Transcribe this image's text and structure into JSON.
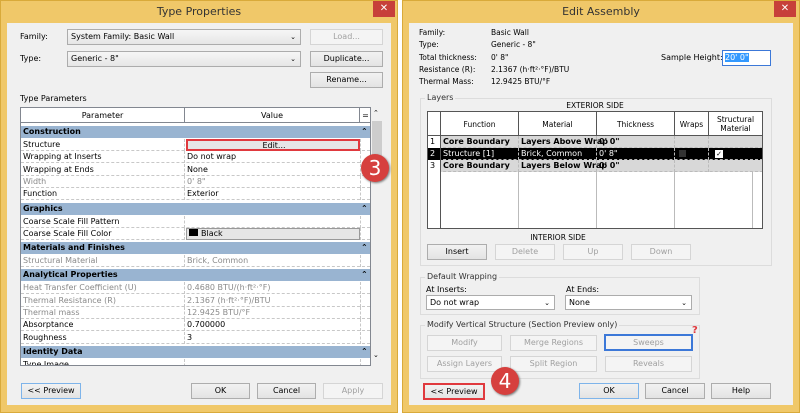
{
  "type_properties": {
    "title": "Type Properties",
    "family_label": "Family:",
    "family_value": "System Family: Basic Wall",
    "type_label": "Type:",
    "type_value": "Generic - 8\"",
    "load": "Load...",
    "duplicate": "Duplicate...",
    "rename": "Rename...",
    "section_label": "Type Parameters",
    "col_parameter": "Parameter",
    "col_value": "Value",
    "rows": [
      {
        "group": "Construction"
      },
      {
        "p": "Structure",
        "v": "Edit...",
        "kind": "button"
      },
      {
        "p": "Wrapping at Inserts",
        "v": "Do not wrap"
      },
      {
        "p": "Wrapping at Ends",
        "v": "None"
      },
      {
        "p": "Width",
        "v": "0'  8\"",
        "gray": true
      },
      {
        "p": "Function",
        "v": "Exterior"
      },
      {
        "group": "Graphics"
      },
      {
        "p": "Coarse Scale Fill Pattern",
        "v": ""
      },
      {
        "p": "Coarse Scale Fill Color",
        "v": "Black",
        "kind": "color"
      },
      {
        "group": "Materials and Finishes"
      },
      {
        "p": "Structural Material",
        "v": "Brick, Common",
        "gray": true
      },
      {
        "group": "Analytical Properties"
      },
      {
        "p": "Heat Transfer Coefficient (U)",
        "v": "0.4680 BTU/(h·ft²·°F)",
        "gray": true
      },
      {
        "p": "Thermal Resistance (R)",
        "v": "2.1367 (h·ft²·°F)/BTU",
        "gray": true
      },
      {
        "p": "Thermal mass",
        "v": "12.9425 BTU/°F",
        "gray": true
      },
      {
        "p": "Absorptance",
        "v": "0.700000"
      },
      {
        "p": "Roughness",
        "v": "3"
      },
      {
        "group": "Identity Data"
      },
      {
        "p": "Type Image",
        "v": ""
      }
    ],
    "preview": "<< Preview",
    "ok": "OK",
    "cancel": "Cancel",
    "apply": "Apply",
    "step_badge": "3"
  },
  "edit_assembly": {
    "title": "Edit Assembly",
    "info": [
      {
        "label": "Family:",
        "value": "Basic Wall"
      },
      {
        "label": "Type:",
        "value": "Generic - 8\""
      },
      {
        "label": "Total thickness:",
        "value": "0'  8\""
      },
      {
        "label": "Resistance (R):",
        "value": "2.1367 (h·ft²·°F)/BTU"
      },
      {
        "label": "Thermal Mass:",
        "value": "12.9425 BTU/°F"
      }
    ],
    "sample_height_label": "Sample Height:",
    "sample_height_value": "20'  0\"",
    "layers_label": "Layers",
    "exterior": "EXTERIOR SIDE",
    "interior": "INTERIOR SIDE",
    "columns": [
      "Function",
      "Material",
      "Thickness",
      "Wraps",
      "Structural Material"
    ],
    "layers": [
      {
        "n": "1",
        "function": "Core Boundary",
        "material": "Layers Above Wrap",
        "thickness": "0'  0\"",
        "bold": true
      },
      {
        "n": "2",
        "function": "Structure [1]",
        "material": "Brick, Common",
        "thickness": "0'  8\"",
        "wraps": false,
        "structural": true,
        "selected": true
      },
      {
        "n": "3",
        "function": "Core Boundary",
        "material": "Layers Below Wrap",
        "thickness": "0'  0\"",
        "bold": true
      }
    ],
    "insert": "Insert",
    "delete": "Delete",
    "up": "Up",
    "down": "Down",
    "default_wrapping": "Default Wrapping",
    "at_inserts_label": "At Inserts:",
    "at_inserts_value": "Do not wrap",
    "at_ends_label": "At  Ends:",
    "at_ends_value": "None",
    "modify_group": "Modify Vertical Structure (Section Preview only)",
    "modify": "Modify",
    "merge": "Merge Regions",
    "sweeps": "Sweeps",
    "assign": "Assign Layers",
    "split": "Split Region",
    "reveals": "Reveals",
    "question_mark": "?",
    "preview": "<< Preview",
    "ok": "OK",
    "cancel": "Cancel",
    "help": "Help",
    "step_badge": "4"
  },
  "colors": {
    "title_bar": "#f0c869",
    "close": "#c7403a",
    "group_row": "#99b4d1",
    "highlight_red": "#e0393e",
    "highlight_blue": "#3c78d8"
  }
}
